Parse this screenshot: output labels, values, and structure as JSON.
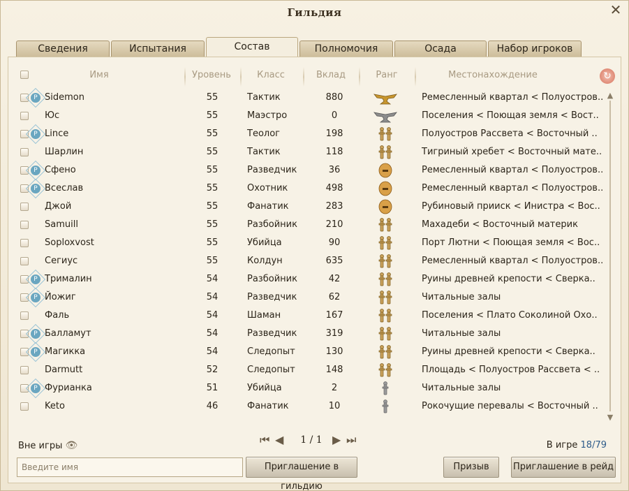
{
  "window": {
    "title": "Гильдия",
    "close": "✕"
  },
  "tabs": [
    {
      "label": "Сведения"
    },
    {
      "label": "Испытания"
    },
    {
      "label": "Состав",
      "active": true
    },
    {
      "label": "Полномочия"
    },
    {
      "label": "Осада"
    },
    {
      "label": "Набор игроков"
    }
  ],
  "columns": {
    "name": "Имя",
    "level": "Уровень",
    "class": "Класс",
    "contribution": "Вклад",
    "rank": "Ранг",
    "location": "Местонахождение"
  },
  "members": [
    {
      "name": "Sidemon",
      "badge": "P",
      "level": "55",
      "class": "Тактик",
      "contribution": "880",
      "rank_icon": "rank-eagle-gold-icon",
      "location": "Ремесленный квартал < Полуостров.."
    },
    {
      "name": "Юс",
      "badge": "",
      "level": "55",
      "class": "Маэстро",
      "contribution": "0",
      "rank_icon": "rank-eagle-silver-icon",
      "location": "Поселения < Поющая земля < Вост.."
    },
    {
      "name": "Lince",
      "badge": "P",
      "level": "55",
      "class": "Теолог",
      "contribution": "198",
      "rank_icon": "rank-double-figure-icon",
      "location": "Полуостров Рассвета < Восточный .."
    },
    {
      "name": "Шарлин",
      "badge": "",
      "level": "55",
      "class": "Тактик",
      "contribution": "118",
      "rank_icon": "rank-double-figure-icon",
      "location": "Тигриный хребет < Восточный мате.."
    },
    {
      "name": "Сфено",
      "badge": "P",
      "level": "55",
      "class": "Разведчик",
      "contribution": "36",
      "rank_icon": "rank-helmet-icon",
      "location": "Ремесленный квартал < Полуостров.."
    },
    {
      "name": "Всеслав",
      "badge": "P",
      "level": "55",
      "class": "Охотник",
      "contribution": "498",
      "rank_icon": "rank-helmet-icon",
      "location": "Ремесленный квартал < Полуостров.."
    },
    {
      "name": "Джой",
      "badge": "",
      "level": "55",
      "class": "Фанатик",
      "contribution": "283",
      "rank_icon": "rank-helmet-icon",
      "location": "Рубиновый прииск < Инистра < Вос.."
    },
    {
      "name": "Samuill",
      "badge": "",
      "level": "55",
      "class": "Разбойник",
      "contribution": "210",
      "rank_icon": "rank-double-figure-icon",
      "location": "Махадеби < Восточный материк"
    },
    {
      "name": "Soploxvost",
      "badge": "",
      "level": "55",
      "class": "Убийца",
      "contribution": "90",
      "rank_icon": "rank-double-figure-icon",
      "location": "Порт Лютни < Поющая земля < Вос.."
    },
    {
      "name": "Сегиус",
      "badge": "",
      "level": "55",
      "class": "Колдун",
      "contribution": "635",
      "rank_icon": "rank-double-figure-icon",
      "location": "Ремесленный квартал < Полуостров.."
    },
    {
      "name": "Трималин",
      "badge": "P",
      "level": "54",
      "class": "Разбойник",
      "contribution": "42",
      "rank_icon": "rank-double-figure-icon",
      "location": "Руины древней крепости < Сверка.."
    },
    {
      "name": "Йожиг",
      "badge": "P",
      "level": "54",
      "class": "Разведчик",
      "contribution": "62",
      "rank_icon": "rank-double-figure-icon",
      "location": "Читальные залы"
    },
    {
      "name": "Фаль",
      "badge": "",
      "level": "54",
      "class": "Шаман",
      "contribution": "167",
      "rank_icon": "rank-double-figure-icon",
      "location": "Поселения < Плато Соколиной Охо.."
    },
    {
      "name": "Балламут",
      "badge": "P",
      "level": "54",
      "class": "Разведчик",
      "contribution": "319",
      "rank_icon": "rank-double-figure-icon",
      "location": "Читальные залы"
    },
    {
      "name": "Магикка",
      "badge": "P",
      "level": "54",
      "class": "Следопыт",
      "contribution": "130",
      "rank_icon": "rank-double-figure-icon",
      "location": "Руины древней крепости < Сверка.."
    },
    {
      "name": "Darmutt",
      "badge": "",
      "level": "52",
      "class": "Следопыт",
      "contribution": "148",
      "rank_icon": "rank-double-figure-icon",
      "location": "Площадь < Полуостров Рассвета < .."
    },
    {
      "name": "Фурианка",
      "badge": "P",
      "level": "51",
      "class": "Убийца",
      "contribution": "2",
      "rank_icon": "rank-single-figure-icon",
      "location": "Читальные залы"
    },
    {
      "name": "Keto",
      "badge": "",
      "level": "46",
      "class": "Фанатик",
      "contribution": "10",
      "rank_icon": "rank-single-figure-icon",
      "location": "Рокочущие перевалы < Восточный .."
    }
  ],
  "footer": {
    "offline_label": "Вне игры",
    "page": "1 / 1",
    "online_label": "В игре",
    "online_count": "18/79",
    "name_placeholder": "Введите имя",
    "invite_guild": "Приглашение в гильдию",
    "summon": "Призыв",
    "invite_raid": "Приглашение в рейд"
  },
  "colors": {
    "accent_blue": "#2f5c8a",
    "badge_blue": "#6aa6c0",
    "rank_gold": "#c8962e",
    "rank_silver": "#8c8c8c"
  }
}
